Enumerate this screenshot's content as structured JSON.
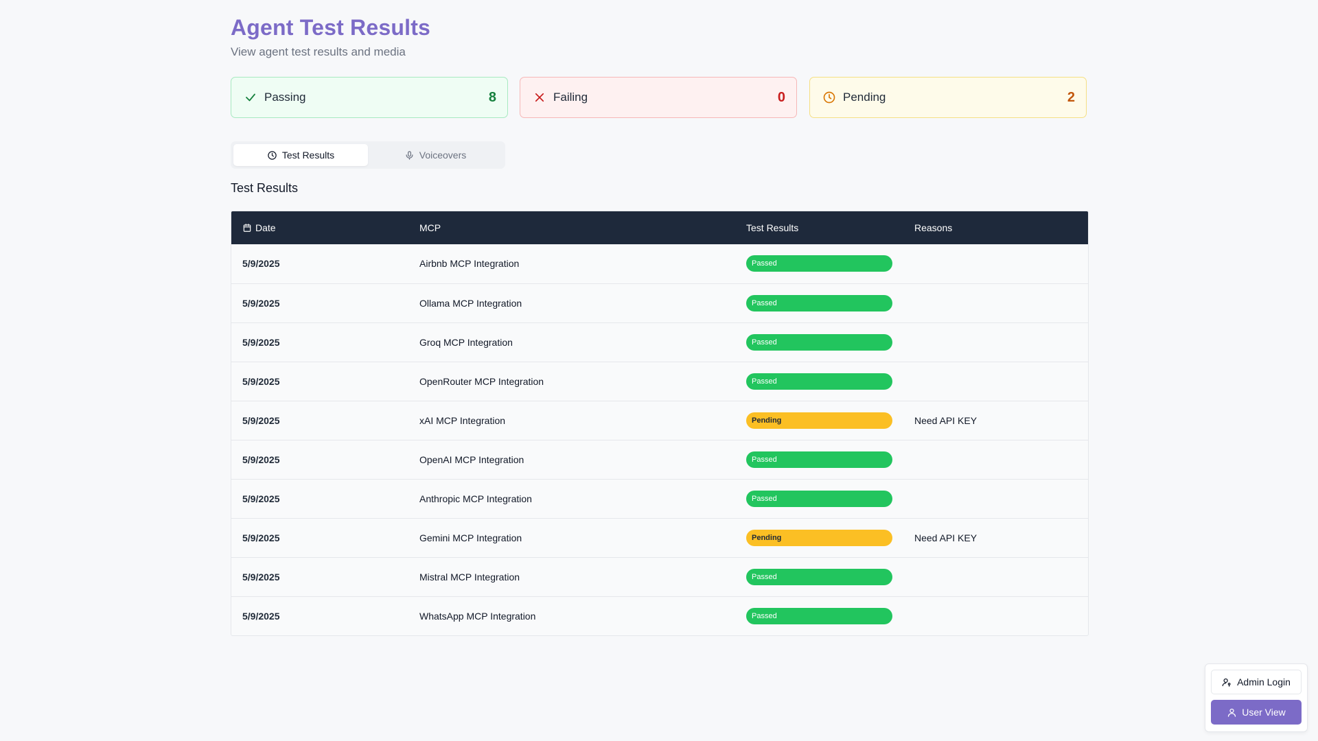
{
  "header": {
    "title": "Agent Test Results",
    "subtitle": "View agent test results and media"
  },
  "stats": {
    "passing": {
      "label": "Passing",
      "value": "8",
      "icon": "check-icon",
      "color": "#15803d"
    },
    "failing": {
      "label": "Failing",
      "value": "0",
      "icon": "x-icon",
      "color": "#c81e1e"
    },
    "pending": {
      "label": "Pending",
      "value": "2",
      "icon": "clock-icon",
      "color": "#c2570c"
    }
  },
  "tabs": [
    {
      "label": "Test Results",
      "icon": "clock-icon",
      "active": true
    },
    {
      "label": "Voiceovers",
      "icon": "microphone-icon",
      "active": false
    }
  ],
  "section_title": "Test Results",
  "table": {
    "columns": [
      "Date",
      "MCP",
      "Test Results",
      "Reasons"
    ],
    "date_icon": "calendar-icon",
    "rows": [
      {
        "date": "5/9/2025",
        "mcp": "Airbnb MCP Integration",
        "result": "Passed",
        "reason": ""
      },
      {
        "date": "5/9/2025",
        "mcp": "Ollama MCP Integration",
        "result": "Passed",
        "reason": ""
      },
      {
        "date": "5/9/2025",
        "mcp": "Groq MCP Integration",
        "result": "Passed",
        "reason": ""
      },
      {
        "date": "5/9/2025",
        "mcp": "OpenRouter MCP Integration",
        "result": "Passed",
        "reason": ""
      },
      {
        "date": "5/9/2025",
        "mcp": "xAI MCP Integration",
        "result": "Pending",
        "reason": "Need API KEY"
      },
      {
        "date": "5/9/2025",
        "mcp": "OpenAI MCP Integration",
        "result": "Passed",
        "reason": ""
      },
      {
        "date": "5/9/2025",
        "mcp": "Anthropic MCP Integration",
        "result": "Passed",
        "reason": ""
      },
      {
        "date": "5/9/2025",
        "mcp": "Gemini MCP Integration",
        "result": "Pending",
        "reason": "Need API KEY"
      },
      {
        "date": "5/9/2025",
        "mcp": "Mistral MCP Integration",
        "result": "Passed",
        "reason": ""
      },
      {
        "date": "5/9/2025",
        "mcp": "WhatsApp MCP Integration",
        "result": "Passed",
        "reason": ""
      }
    ]
  },
  "corner_panel": {
    "admin_login": {
      "label": "Admin Login",
      "icon": "user-key-icon"
    },
    "user_view": {
      "label": "User View",
      "icon": "user-icon"
    }
  },
  "colors": {
    "accent": "#7c6bc7",
    "passed_badge": "#22c55e",
    "pending_badge": "#fbbf24",
    "table_header": "#1e293b"
  }
}
